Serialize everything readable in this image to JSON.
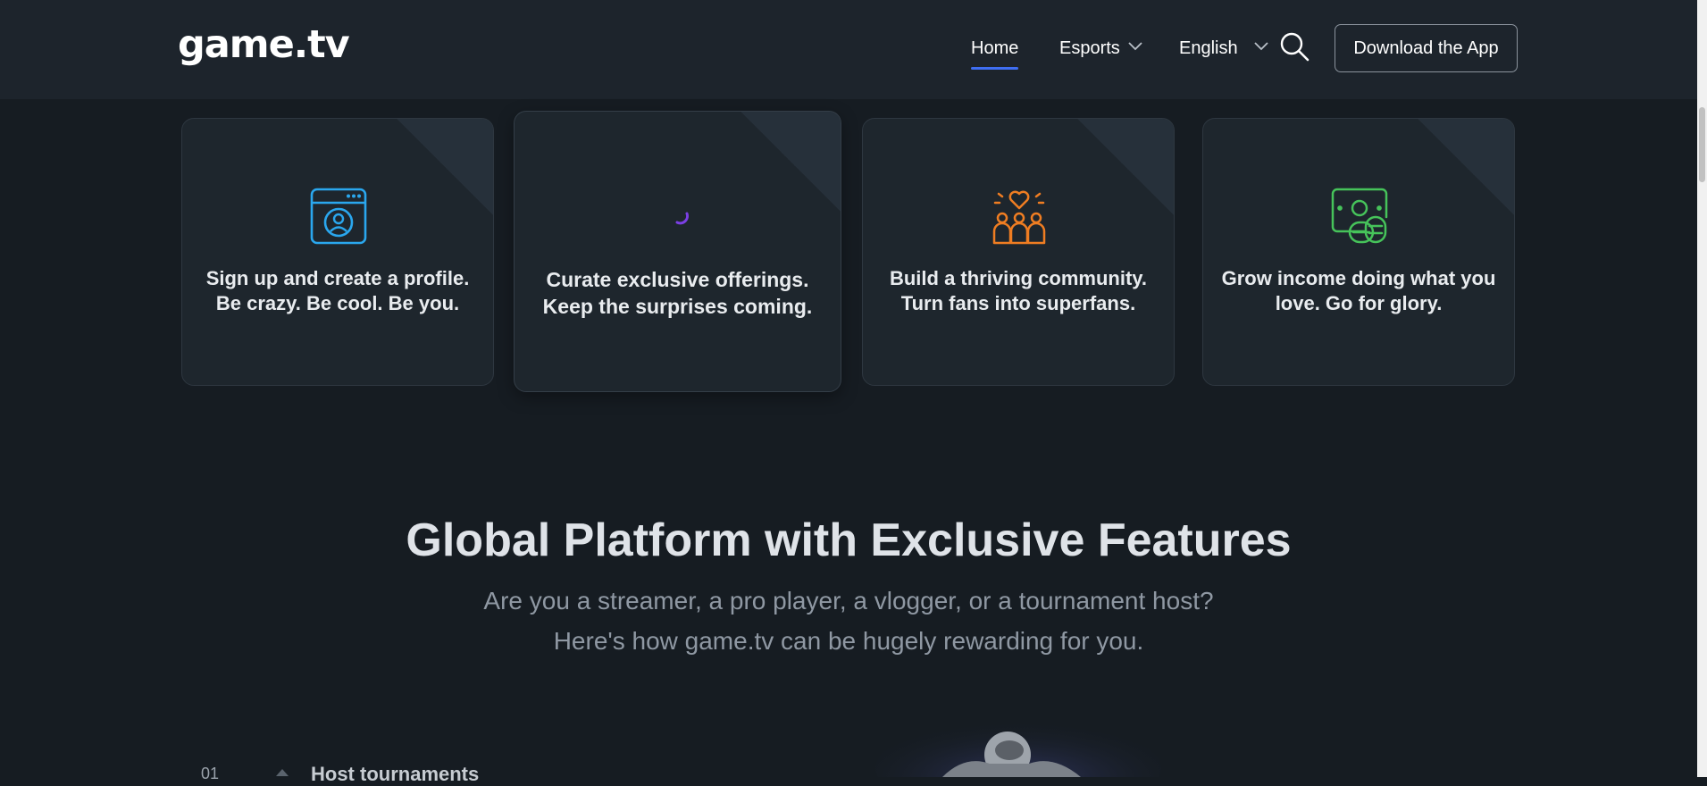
{
  "header": {
    "logo": "game.tv",
    "nav": {
      "home": "Home",
      "esports": "Esports",
      "language": "English"
    },
    "download_label": "Download the App",
    "accent": "#3f6ef2"
  },
  "features": [
    {
      "line1": "Sign up and create a profile.",
      "line2": "Be crazy. Be cool. Be you.",
      "icon": "profile-window-icon",
      "color": "#2aa7ee"
    },
    {
      "line1": "Curate exclusive offerings.",
      "line2": "Keep the surprises coming.",
      "icon": "loading-spinner-icon",
      "color": "#7b3fe4"
    },
    {
      "line1": "Build a thriving community.",
      "line2": "Turn fans into superfans.",
      "icon": "community-heart-icon",
      "color": "#ef7d22"
    },
    {
      "line1": "Grow income doing what you",
      "line2": "love. Go for glory.",
      "icon": "income-coins-icon",
      "color": "#46c35a"
    }
  ],
  "section": {
    "title": "Global Platform with Exclusive Features",
    "subtitle_line1": "Are you a streamer, a pro player, a vlogger, or a tournament host?",
    "subtitle_line2": "Here's how game.tv can be hugely rewarding for you."
  },
  "peek": {
    "number": "01",
    "item": "Host tournaments"
  }
}
